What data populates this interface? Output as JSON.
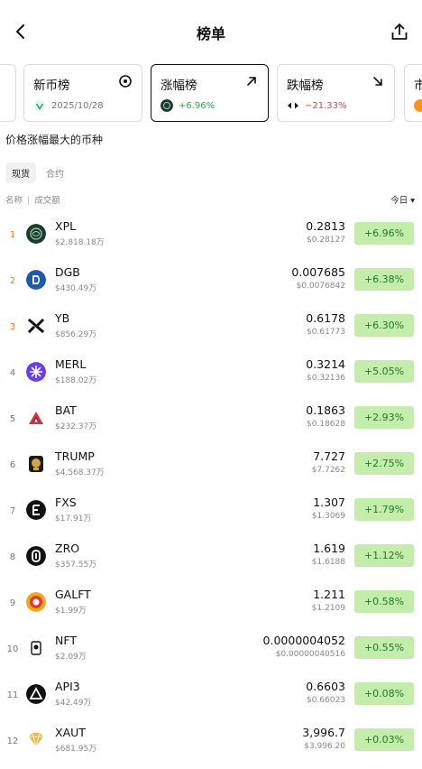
{
  "header": {
    "title": "榜单",
    "back_icon": "chevron-left-icon",
    "share_icon": "share-icon"
  },
  "cards": [
    {
      "title": "新币榜",
      "icon": "target-icon",
      "sub": "2025/10/28",
      "sub_color": "#777777"
    },
    {
      "title": "涨幅榜",
      "icon": "arrow-up-right-icon",
      "sub": "+6.96%",
      "sub_color": "#25a745",
      "active": true
    },
    {
      "title": "跌幅榜",
      "icon": "arrow-down-right-icon",
      "sub": "−21.33%",
      "sub_color": "#e0404a"
    },
    {
      "title": "市",
      "icon": "",
      "sub": "",
      "sub_color": "#777777"
    }
  ],
  "section_title": "价格涨幅最大的币种",
  "subtabs": [
    {
      "label": "现货",
      "active": true
    },
    {
      "label": "合约",
      "active": false
    }
  ],
  "columns": {
    "name": "名称",
    "volume": "成交额",
    "time_filter": "今日 ▾"
  },
  "rows": [
    {
      "rank": "1",
      "symbol": "XPL",
      "volume": "$2,818.18万",
      "price": "0.2813",
      "usd": "$0.28127",
      "change": "+6.96%",
      "logo_color": "#1d3b2f"
    },
    {
      "rank": "2",
      "symbol": "DGB",
      "volume": "$430.49万",
      "price": "0.007685",
      "usd": "$0.0076842",
      "change": "+6.38%",
      "logo_color": "#1b5ab0"
    },
    {
      "rank": "3",
      "symbol": "YB",
      "volume": "$856.29万",
      "price": "0.6178",
      "usd": "$0.61773",
      "change": "+6.30%",
      "logo_color": "#ffffff"
    },
    {
      "rank": "4",
      "symbol": "MERL",
      "volume": "$188.02万",
      "price": "0.3214",
      "usd": "$0.32136",
      "change": "+5.05%",
      "logo_color": "#6a3cf0"
    },
    {
      "rank": "5",
      "symbol": "BAT",
      "volume": "$232.37万",
      "price": "0.1863",
      "usd": "$0.18628",
      "change": "+2.93%",
      "logo_color": "#ffffff"
    },
    {
      "rank": "6",
      "symbol": "TRUMP",
      "volume": "$4,568.37万",
      "price": "7.727",
      "usd": "$7.7262",
      "change": "+2.75%",
      "logo_color": "#1a1a1a"
    },
    {
      "rank": "7",
      "symbol": "FXS",
      "volume": "$17.91万",
      "price": "1.307",
      "usd": "$1.3069",
      "change": "+1.79%",
      "logo_color": "#111111"
    },
    {
      "rank": "8",
      "symbol": "ZRO",
      "volume": "$357.55万",
      "price": "1.619",
      "usd": "$1.6188",
      "change": "+1.12%",
      "logo_color": "#111111"
    },
    {
      "rank": "9",
      "symbol": "GALFT",
      "volume": "$1.99万",
      "price": "1.211",
      "usd": "$1.2109",
      "change": "+0.58%",
      "logo_color": "#f2a81c"
    },
    {
      "rank": "10",
      "symbol": "NFT",
      "volume": "$2.09万",
      "price": "0.0000004052",
      "usd": "$0.00000040516",
      "change": "+0.55%",
      "logo_color": "#ffffff"
    },
    {
      "rank": "11",
      "symbol": "API3",
      "volume": "$42.49万",
      "price": "0.6603",
      "usd": "$0.66023",
      "change": "+0.08%",
      "logo_color": "#111111"
    },
    {
      "rank": "12",
      "symbol": "XAUT",
      "volume": "$681.95万",
      "price": "3,996.7",
      "usd": "$3,996.20",
      "change": "+0.03%",
      "logo_color": "#ffffff"
    }
  ]
}
